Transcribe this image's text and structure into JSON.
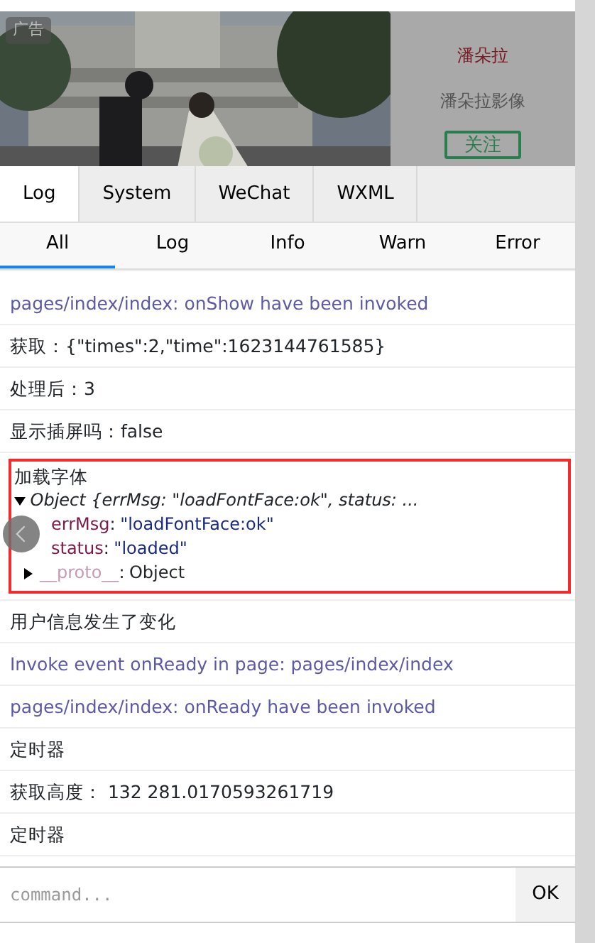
{
  "ad": {
    "label": "广告",
    "brand_logo": "潘朵拉",
    "brand_name": "潘朵拉影像",
    "follow_button": "关注"
  },
  "tabs": [
    {
      "label": "Log",
      "selected": true
    },
    {
      "label": "System",
      "selected": false
    },
    {
      "label": "WeChat",
      "selected": false
    },
    {
      "label": "WXML",
      "selected": false
    }
  ],
  "filters": [
    {
      "label": "All",
      "selected": true
    },
    {
      "label": "Log",
      "selected": false
    },
    {
      "label": "Info",
      "selected": false
    },
    {
      "label": "Warn",
      "selected": false
    },
    {
      "label": "Error",
      "selected": false
    }
  ],
  "entries": [
    {
      "kind": "system",
      "text": "pages/index/index: onShow have been invoked"
    },
    {
      "kind": "log",
      "text": "获取：{\"times\":2,\"time\":1623144761585}"
    },
    {
      "kind": "log",
      "text": "处理后：3"
    },
    {
      "kind": "log",
      "text": "显示插屏吗：false"
    },
    {
      "kind": "object",
      "title": "加载字体",
      "summary": "Object {errMsg: \"loadFontFace:ok\", status: ...",
      "expanded": true,
      "highlighted": true,
      "properties": [
        {
          "key": "errMsg",
          "separator": ":",
          "value": "\"loadFontFace:ok\""
        },
        {
          "key": "status",
          "separator": ":",
          "value": "\"loaded\""
        }
      ],
      "proto": {
        "key": "__proto__",
        "separator": ":",
        "value": "Object",
        "expanded": false
      }
    },
    {
      "kind": "log",
      "text": "用户信息发生了变化"
    },
    {
      "kind": "system",
      "text": "Invoke event onReady in page: pages/index/index"
    },
    {
      "kind": "system",
      "text": "pages/index/index: onReady have been invoked"
    },
    {
      "kind": "log",
      "text": "定时器"
    },
    {
      "kind": "log",
      "text": "获取高度： 132 281.0170593261719"
    },
    {
      "kind": "log",
      "text": "定时器"
    }
  ],
  "command": {
    "placeholder": "command...",
    "button": "OK"
  }
}
